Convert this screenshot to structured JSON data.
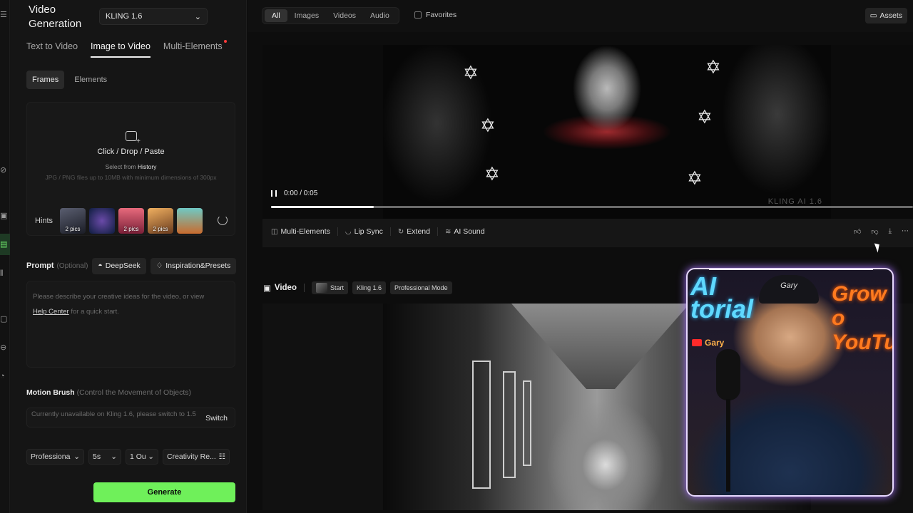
{
  "app": {
    "title": "Video Generation",
    "menu_icon": "menu-icon"
  },
  "model": {
    "selected": "KLING 1.6"
  },
  "mode_tabs": [
    {
      "label": "Text to Video",
      "active": false
    },
    {
      "label": "Image to Video",
      "active": true
    },
    {
      "label": "Multi-Elements",
      "active": false,
      "badge_dot": true
    }
  ],
  "sub_tabs": [
    {
      "label": "Frames",
      "active": true
    },
    {
      "label": "Elements",
      "active": false
    }
  ],
  "upload": {
    "main": "Click / Drop / Paste",
    "history_prefix": "Select from",
    "history_link": "History",
    "note": "JPG / PNG files up to 10MB with minimum dimensions of 300px"
  },
  "hints": {
    "label": "Hints",
    "items": [
      {
        "caption": "2 pics",
        "color": "#3a3b45"
      },
      {
        "caption": "",
        "color": "#1f3d6b"
      },
      {
        "caption": "2 pics",
        "color": "#c2465a"
      },
      {
        "caption": "2 pics",
        "color": "#b67d3e"
      },
      {
        "caption": "",
        "color": "#2f8a8a"
      }
    ]
  },
  "prompt": {
    "label": "Prompt",
    "optional": "(Optional)",
    "deepseek": "DeepSeek",
    "presets": "Inspiration&Presets",
    "placeholder": "Please describe your creative ideas for the video, or view",
    "help_link": "Help Center",
    "help_suffix": "for a quick start."
  },
  "motion_brush": {
    "label": "Motion Brush",
    "hint": "(Control the Movement of Objects)",
    "unavailable": "Currently unavailable on Kling 1.6, please switch to 1.5",
    "switch": "Switch"
  },
  "settings": {
    "mode": "Professiona",
    "duration": "5s",
    "outputs": "1 Ou",
    "creativity": "Creativity Re..."
  },
  "generate_label": "Generate",
  "filters": {
    "items": [
      {
        "label": "All",
        "active": true
      },
      {
        "label": "Images",
        "active": false
      },
      {
        "label": "Videos",
        "active": false
      },
      {
        "label": "Audio",
        "active": false
      }
    ],
    "favorites": "Favorites",
    "assets": "Assets"
  },
  "video1": {
    "time": "0:00 / 0:05",
    "progress_percent": 16,
    "watermark": "KLING AI 1.6",
    "actions": [
      "Multi-Elements",
      "Lip Sync",
      "Extend",
      "AI Sound"
    ]
  },
  "video2": {
    "title": "Video",
    "tags": [
      "Start",
      "Kling 1.6",
      "Professional Mode"
    ]
  },
  "webcam": {
    "neon_left_1": "AI",
    "neon_left_2": "torial",
    "neon_right_1": "Grow o",
    "neon_right_2": "YouTul",
    "channel": "Gary",
    "cap_text": "Gary"
  },
  "colors": {
    "accent_green": "#6ff05a",
    "badge_red": "#ff3b3b"
  }
}
